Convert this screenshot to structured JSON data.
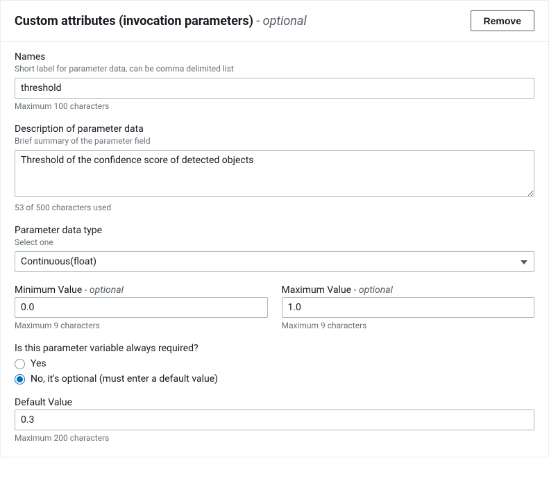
{
  "header": {
    "title": "Custom attributes (invocation parameters)",
    "optional_suffix": " - optional",
    "remove_label": "Remove"
  },
  "names": {
    "label": "Names",
    "hint": "Short label for parameter data, can be comma delimited list",
    "value": "threshold",
    "constraint": "Maximum 100 characters"
  },
  "description": {
    "label": "Description of parameter data",
    "hint": "Brief summary of the parameter field",
    "value": "Threshold of the confidence score of detected objects",
    "constraint": "53 of 500 characters used"
  },
  "data_type": {
    "label": "Parameter data type",
    "hint": "Select one",
    "value": "Continuous(float)"
  },
  "min_value": {
    "label": "Minimum Value",
    "optional_suffix": " - optional",
    "value": "0.0",
    "constraint": "Maximum 9 characters"
  },
  "max_value": {
    "label": "Maximum Value",
    "optional_suffix": " - optional",
    "value": "1.0",
    "constraint": "Maximum 9 characters"
  },
  "required": {
    "question": "Is this parameter variable always required?",
    "option_yes": "Yes",
    "option_no": "No, it's optional (must enter a default value)"
  },
  "default_value": {
    "label": "Default Value",
    "value": "0.3",
    "constraint": "Maximum 200 characters"
  }
}
